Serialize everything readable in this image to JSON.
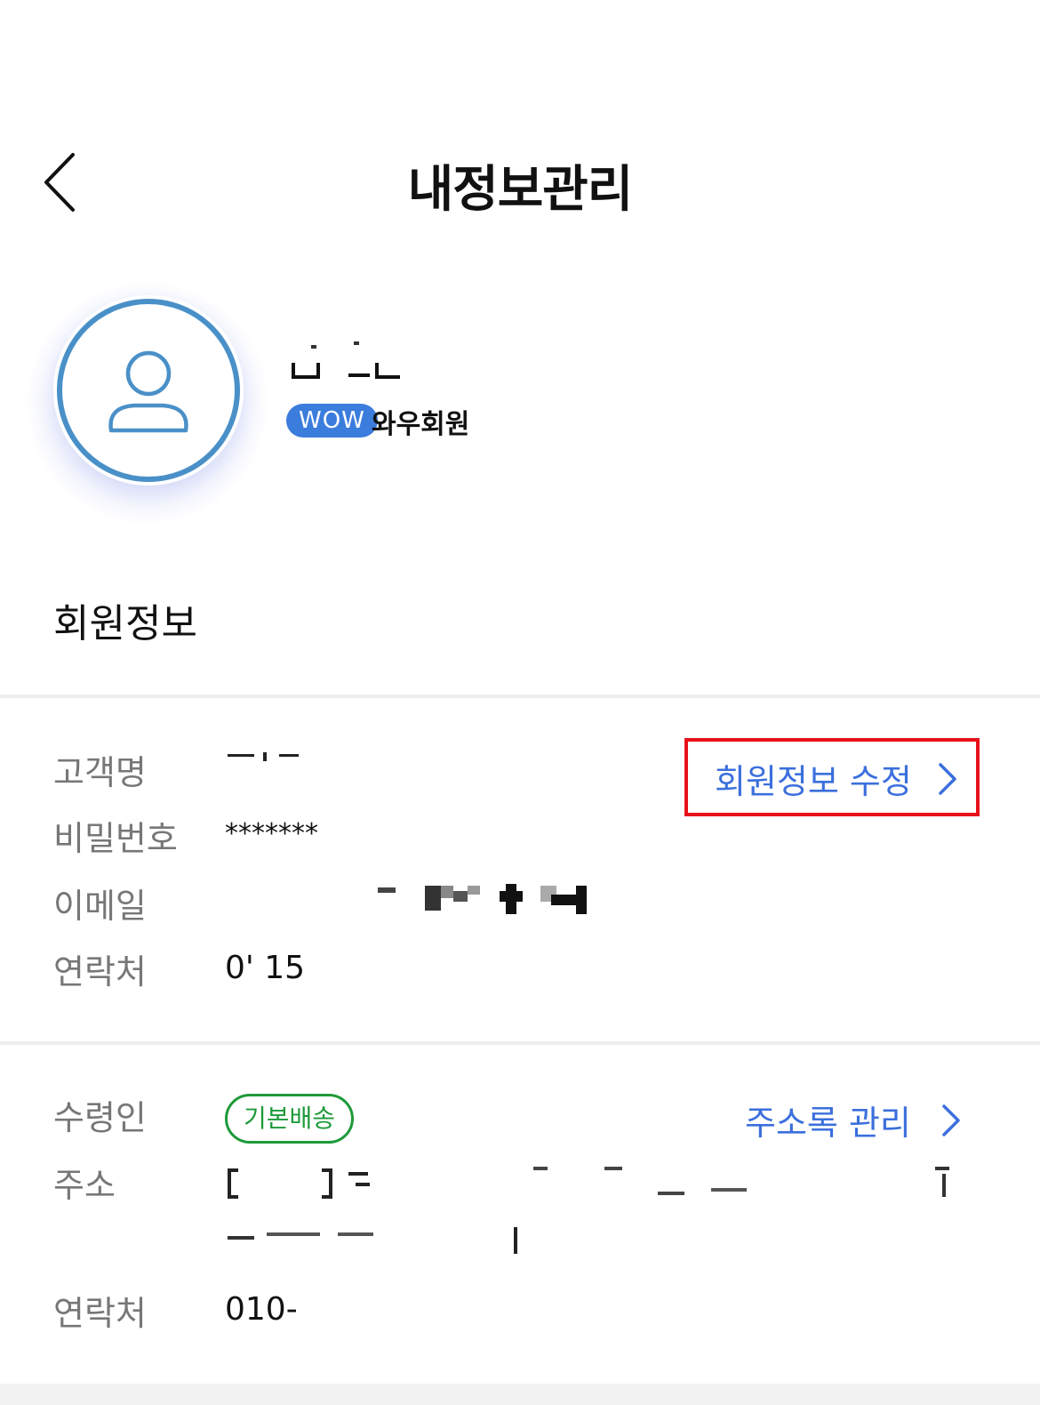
{
  "header": {
    "title": "내정보관리",
    "back_icon": "chevron-left-icon"
  },
  "profile": {
    "membership_badge": "WOW",
    "membership_label": "와우회원",
    "avatar_icon": "user-icon",
    "colors": {
      "avatar_ring": "#4a90c8",
      "badge_bg": "#3b7ddd"
    }
  },
  "member_info": {
    "section_title": "회원정보",
    "edit_link_label": "회원정보 수정",
    "rows": [
      {
        "label": "고객명",
        "value": ""
      },
      {
        "label": "비밀번호",
        "value": "*******"
      },
      {
        "label": "이메일",
        "value": ""
      },
      {
        "label": "연락처",
        "value": "0' 15"
      }
    ]
  },
  "delivery": {
    "address_book_link_label": "주소록 관리",
    "default_badge": "기본배송",
    "rows": [
      {
        "label": "수령인",
        "value": ""
      },
      {
        "label": "주소",
        "value": "[ ]"
      },
      {
        "label": "연락처",
        "value": "010-"
      }
    ]
  },
  "colors": {
    "link_blue": "#3b6fdd",
    "highlight_red": "#e8101a",
    "badge_green": "#1e9a3a"
  }
}
